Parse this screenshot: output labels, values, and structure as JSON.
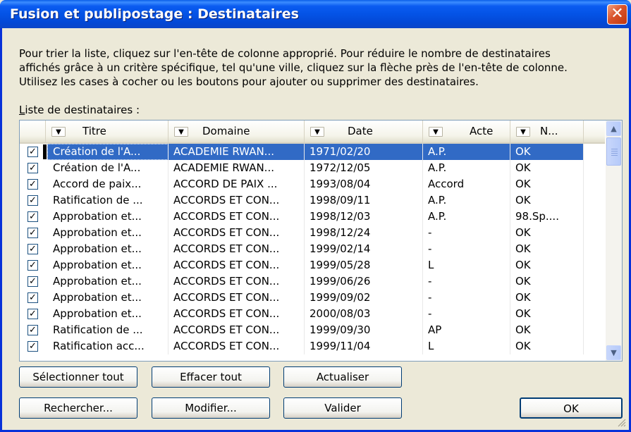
{
  "window": {
    "title": "Fusion et publipostage : Destinataires",
    "close_glyph": "✕"
  },
  "intro": {
    "line1": "Pour trier la liste, cliquez sur l'en-tête de colonne approprié. Pour réduire le nombre de destinataires",
    "line2": "affichés grâce à un critère spécifique, tel qu'une ville, cliquez sur la flèche près de l'en-tête de colonne.",
    "line3": "Utilisez les cases à cocher ou les boutons pour ajouter ou supprimer des destinataires."
  },
  "list_label": {
    "accel": "L",
    "rest": "iste de destinataires :"
  },
  "columns": [
    "Titre",
    "Domaine",
    "Date",
    "Acte",
    "N..."
  ],
  "dropdown_glyph": "▼",
  "rows": [
    {
      "titre": "Création de l'A...",
      "domaine": "ACADEMIE RWAN...",
      "date": "1971/02/20",
      "acte": "A.P.",
      "n": "OK",
      "checked": true
    },
    {
      "titre": "Création de l'A...",
      "domaine": "ACADEMIE RWAN...",
      "date": "1972/12/05",
      "acte": "A.P.",
      "n": "OK",
      "checked": true
    },
    {
      "titre": "Accord de paix...",
      "domaine": "ACCORD DE PAIX ...",
      "date": "1993/08/04",
      "acte": "Accord",
      "n": "OK",
      "checked": true
    },
    {
      "titre": "Ratification de ...",
      "domaine": "ACCORDS ET CON...",
      "date": "1998/09/11",
      "acte": "A.P.",
      "n": "OK",
      "checked": true
    },
    {
      "titre": "Approbation et...",
      "domaine": "ACCORDS ET CON...",
      "date": "1998/12/03",
      "acte": "A.P.",
      "n": "98.Sp....",
      "checked": true
    },
    {
      "titre": "Approbation et...",
      "domaine": "ACCORDS ET CON...",
      "date": "1998/12/24",
      "acte": "-",
      "n": "OK",
      "checked": true
    },
    {
      "titre": "Approbation et...",
      "domaine": "ACCORDS ET CON...",
      "date": "1999/02/14",
      "acte": "-",
      "n": "OK",
      "checked": true
    },
    {
      "titre": "Approbation et...",
      "domaine": "ACCORDS ET CON...",
      "date": "1999/05/28",
      "acte": "L",
      "n": "OK",
      "checked": true
    },
    {
      "titre": "Approbation et...",
      "domaine": "ACCORDS ET CON...",
      "date": "1999/06/26",
      "acte": "-",
      "n": "OK",
      "checked": true
    },
    {
      "titre": "Approbation et...",
      "domaine": "ACCORDS ET CON...",
      "date": "1999/09/02",
      "acte": "-",
      "n": "OK",
      "checked": true
    },
    {
      "titre": "Approbation et...",
      "domaine": "ACCORDS ET CON...",
      "date": "2000/08/03",
      "acte": "-",
      "n": "OK",
      "checked": true
    },
    {
      "titre": "Ratification de ...",
      "domaine": "ACCORDS ET CON...",
      "date": "1999/09/30",
      "acte": "AP",
      "n": "OK",
      "checked": true
    },
    {
      "titre": "Ratification acc...",
      "domaine": "ACCORDS ET CON...",
      "date": "1999/11/04",
      "acte": "L",
      "n": "OK",
      "checked": true
    }
  ],
  "selected_row": 0,
  "scroll": {
    "up_glyph": "▲",
    "down_glyph": "▼"
  },
  "buttons": {
    "select_all": "Sélectionner tout",
    "clear_all": "Effacer tout",
    "refresh": "Actualiser",
    "find": "Rechercher...",
    "edit": "Modifier...",
    "validate": "Valider",
    "ok": "OK"
  },
  "colors": {
    "titlebar": "#0453e6",
    "selection": "#316ac5",
    "dialog_bg": "#ece9d8",
    "close_button": "#d9532c"
  }
}
